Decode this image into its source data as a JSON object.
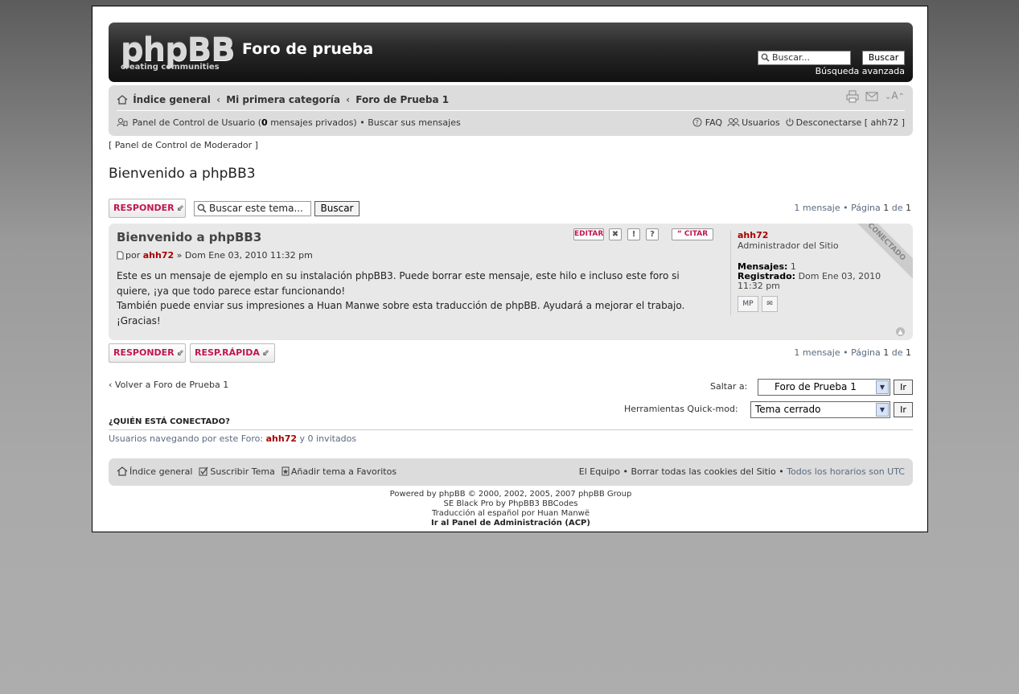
{
  "header": {
    "logo_main": "phpBB",
    "logo_sub": "creating communities",
    "site_title": "Foro de prueba",
    "search_placeholder": "Buscar...",
    "search_button": "Buscar",
    "advanced_search": "Búsqueda avanzada"
  },
  "breadcrumbs": [
    "Índice general",
    "Mi primera categoría",
    "Foro de Prueba 1"
  ],
  "navbar": {
    "ucp_label": "Panel de Control de Usuario",
    "pm_count": "0",
    "pm_label": "mensajes privados",
    "own_posts": "Buscar sus mensajes",
    "faq": "FAQ",
    "members": "Usuarios",
    "logout": "Desconectarse [ ahh72 ]",
    "font_size": "A"
  },
  "mcp_link": "[ Panel de Control de Moderador ]",
  "topic_title": "Bienvenido a phpBB3",
  "actions": {
    "reply": "RESPONDER",
    "quick_reply": "RESP.RÁPIDA",
    "topic_search_placeholder": "Buscar este tema...",
    "topic_search_button": "Buscar",
    "pagination_count": "1 mensaje",
    "pagination_page": "Página",
    "pagination_current": "1",
    "pagination_of": "de",
    "pagination_total": "1"
  },
  "post": {
    "title": "Bienvenido a phpBB3",
    "by": "por",
    "author": "ahh72",
    "date": "» Dom Ene 03, 2010 11:32 pm",
    "body_1": "Este es un mensaje de ejemplo en su instalación phpBB3. Puede borrar este mensaje, este hilo e incluso este foro si quiere, ¡ya que todo parece estar funcionando!",
    "body_2": "También puede enviar sus impresiones a Huan Manwe sobre esta traducción de phpBB. Ayudará a mejorar el trabajo.",
    "body_3": "¡Gracias!",
    "buttons": {
      "edit": "EDITAR",
      "quote": "CITAR"
    }
  },
  "profile": {
    "name": "ahh72",
    "rank": "Administrador del Sitio",
    "posts_label": "Mensajes:",
    "posts_value": "1",
    "joined_label": "Registrado:",
    "joined_value": "Dom Ene 03, 2010 11:32 pm",
    "pm_icon_text": "MP",
    "online_ribbon": "CONECTADO"
  },
  "navigation": {
    "back_link": "Volver a Foro de Prueba 1",
    "jump_label": "Saltar a:",
    "jump_value": "Foro de Prueba 1",
    "go": "Ir",
    "quickmod_label": "Herramientas Quick-mod:",
    "quickmod_value": "Tema cerrado"
  },
  "whois": {
    "title": "¿QUIÉN ESTÁ CONECTADO?",
    "prefix": "Usuarios navegando por este Foro:",
    "user": "ahh72",
    "suffix": "y 0 invitados"
  },
  "footer": {
    "index": "Índice general",
    "subscribe": "Suscribir Tema",
    "bookmark": "Añadir tema a Favoritos",
    "team": "El Equipo",
    "delete_cookies": "Borrar todas las cookies del Sitio",
    "timezone": "Todos los horarios son UTC"
  },
  "credits": {
    "line1": "Powered by phpBB © 2000, 2002, 2005, 2007 phpBB Group",
    "line2": "SE Black Pro by PhpBB3 BBCodes",
    "line3": "Traducción al español por Huan Manwë",
    "line4": "Ir al Panel de Administración (ACP)"
  },
  "colors": {
    "accent": "#c0174e",
    "author": "#aa0000",
    "link_muted": "#5a6a80"
  }
}
